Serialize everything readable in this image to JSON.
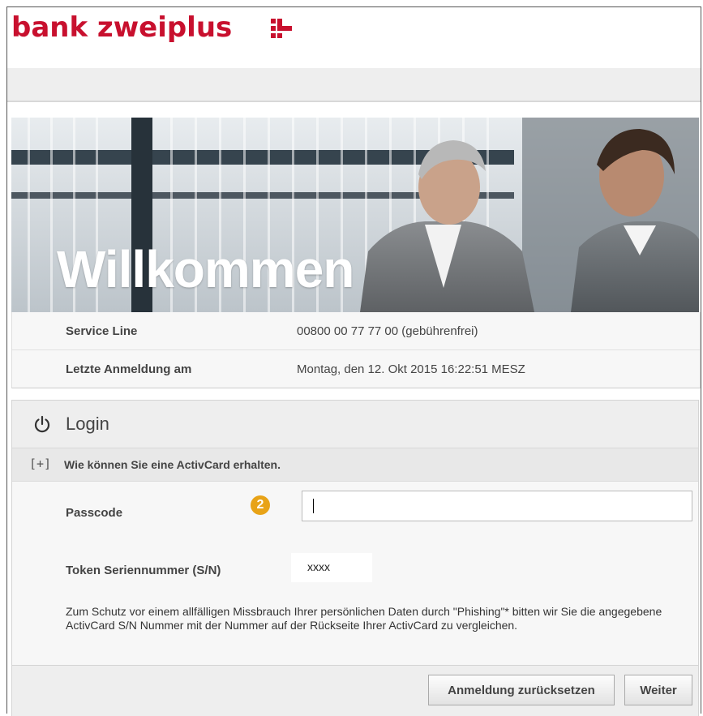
{
  "brand": {
    "name": "bank zweiplus",
    "color": "#c8102e"
  },
  "hero": {
    "title": "Willkommen"
  },
  "info": [
    {
      "label": "Service Line",
      "value": "00800 00 77 77 00 (gebührenfrei)"
    },
    {
      "label": "Letzte Anmeldung am",
      "value": "Montag, den 12. Okt 2015 16:22:51 MESZ"
    }
  ],
  "login": {
    "title": "Login",
    "icon": "power-icon",
    "activcard_link": "Wie können Sie eine ActivCard erhalten.",
    "expand_icon": "[+]",
    "passcode_label": "Passcode",
    "step_badge": "2",
    "passcode_value": "",
    "token_label": "Token Seriennummer (S/N)",
    "token_value": "xxxx",
    "notice": "Zum Schutz vor einem allfälligen Missbrauch Ihrer persönlichen Daten durch \"Phishing\"* bitten wir Sie die angegebene ActivCard S/N Nummer mit der Nummer auf der Rückseite Ihrer ActivCard zu vergleichen.",
    "reset_button": "Anmeldung zurücksetzen",
    "next_button": "Weiter"
  }
}
